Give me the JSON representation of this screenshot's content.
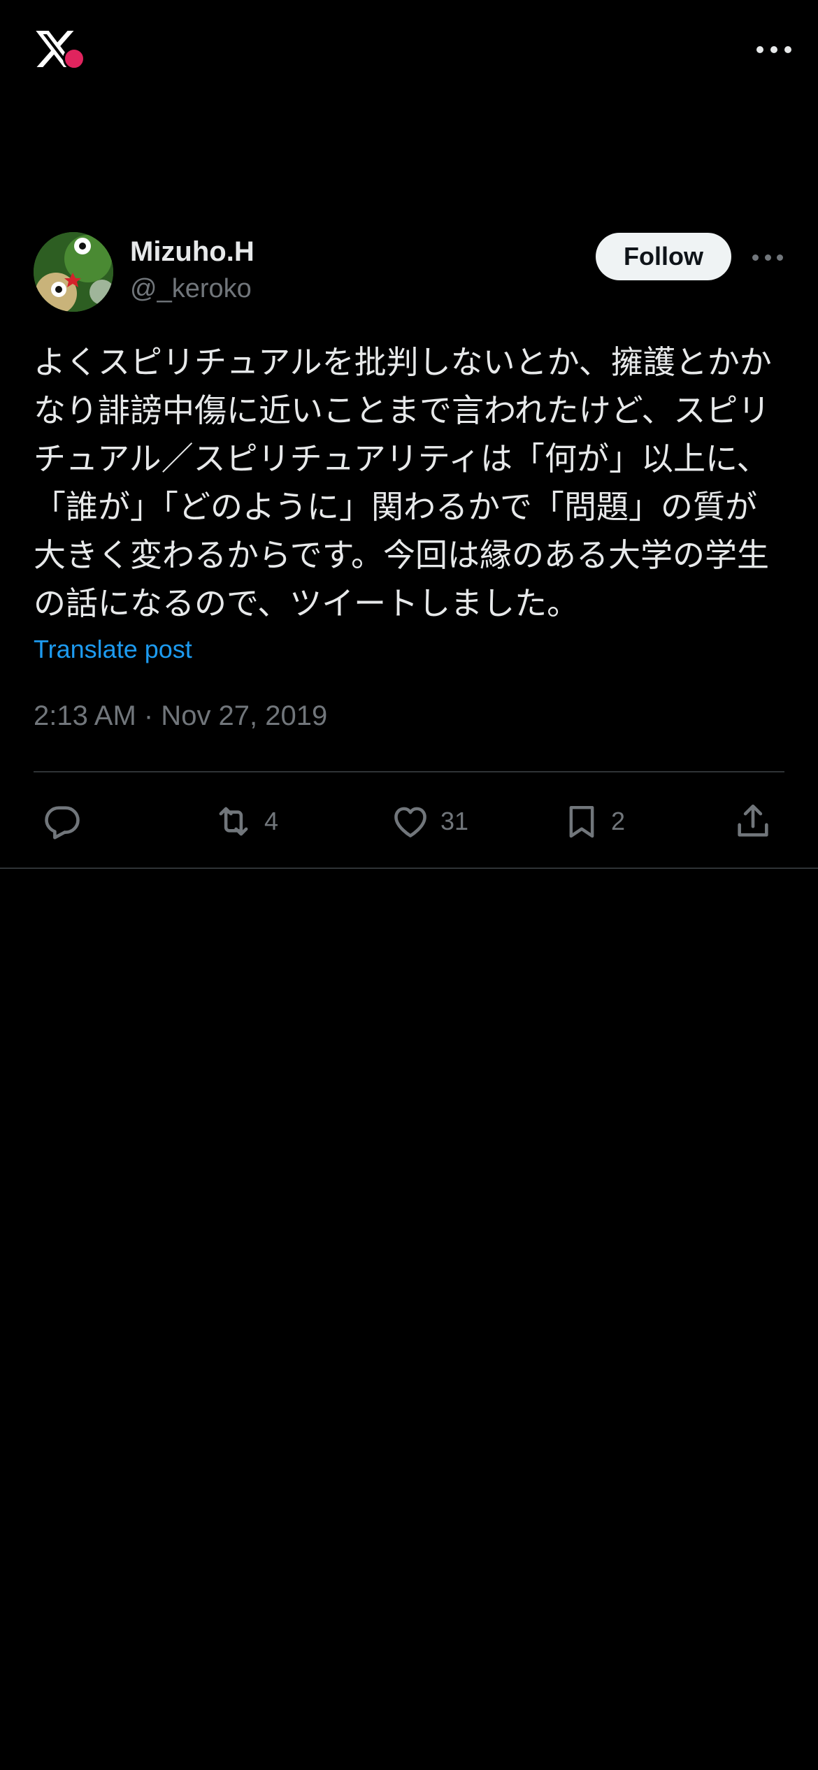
{
  "topbar": {
    "logo_icon": "x-logo",
    "more_icon": "more-horizontal-icon"
  },
  "author": {
    "name": "Mizuho.H",
    "handle": "@_keroko",
    "follow_label": "Follow"
  },
  "post": {
    "text": "よくスピリチュアルを批判しないとか、擁護とかかなり誹謗中傷に近いことまで言われたけど、スピリチュアル／スピリチュアリティは「何が」以上に、「誰が」「どのように」関わるかで「問題」の質が大きく変わるからです。今回は縁のある大学の学生の話になるので、ツイートしました。",
    "translate_label": "Translate post",
    "timestamp": "2:13 AM · Nov 27, 2019"
  },
  "actions": {
    "reply_icon": "reply-icon",
    "repost_count": "4",
    "like_count": "31",
    "bookmark_count": "2",
    "share_icon": "share-icon"
  },
  "colors": {
    "background": "#000000",
    "text_primary": "#e7e9ea",
    "text_secondary": "#71767b",
    "link": "#1d9bf0",
    "divider": "#2f3336",
    "follow_bg": "#eff3f4"
  }
}
